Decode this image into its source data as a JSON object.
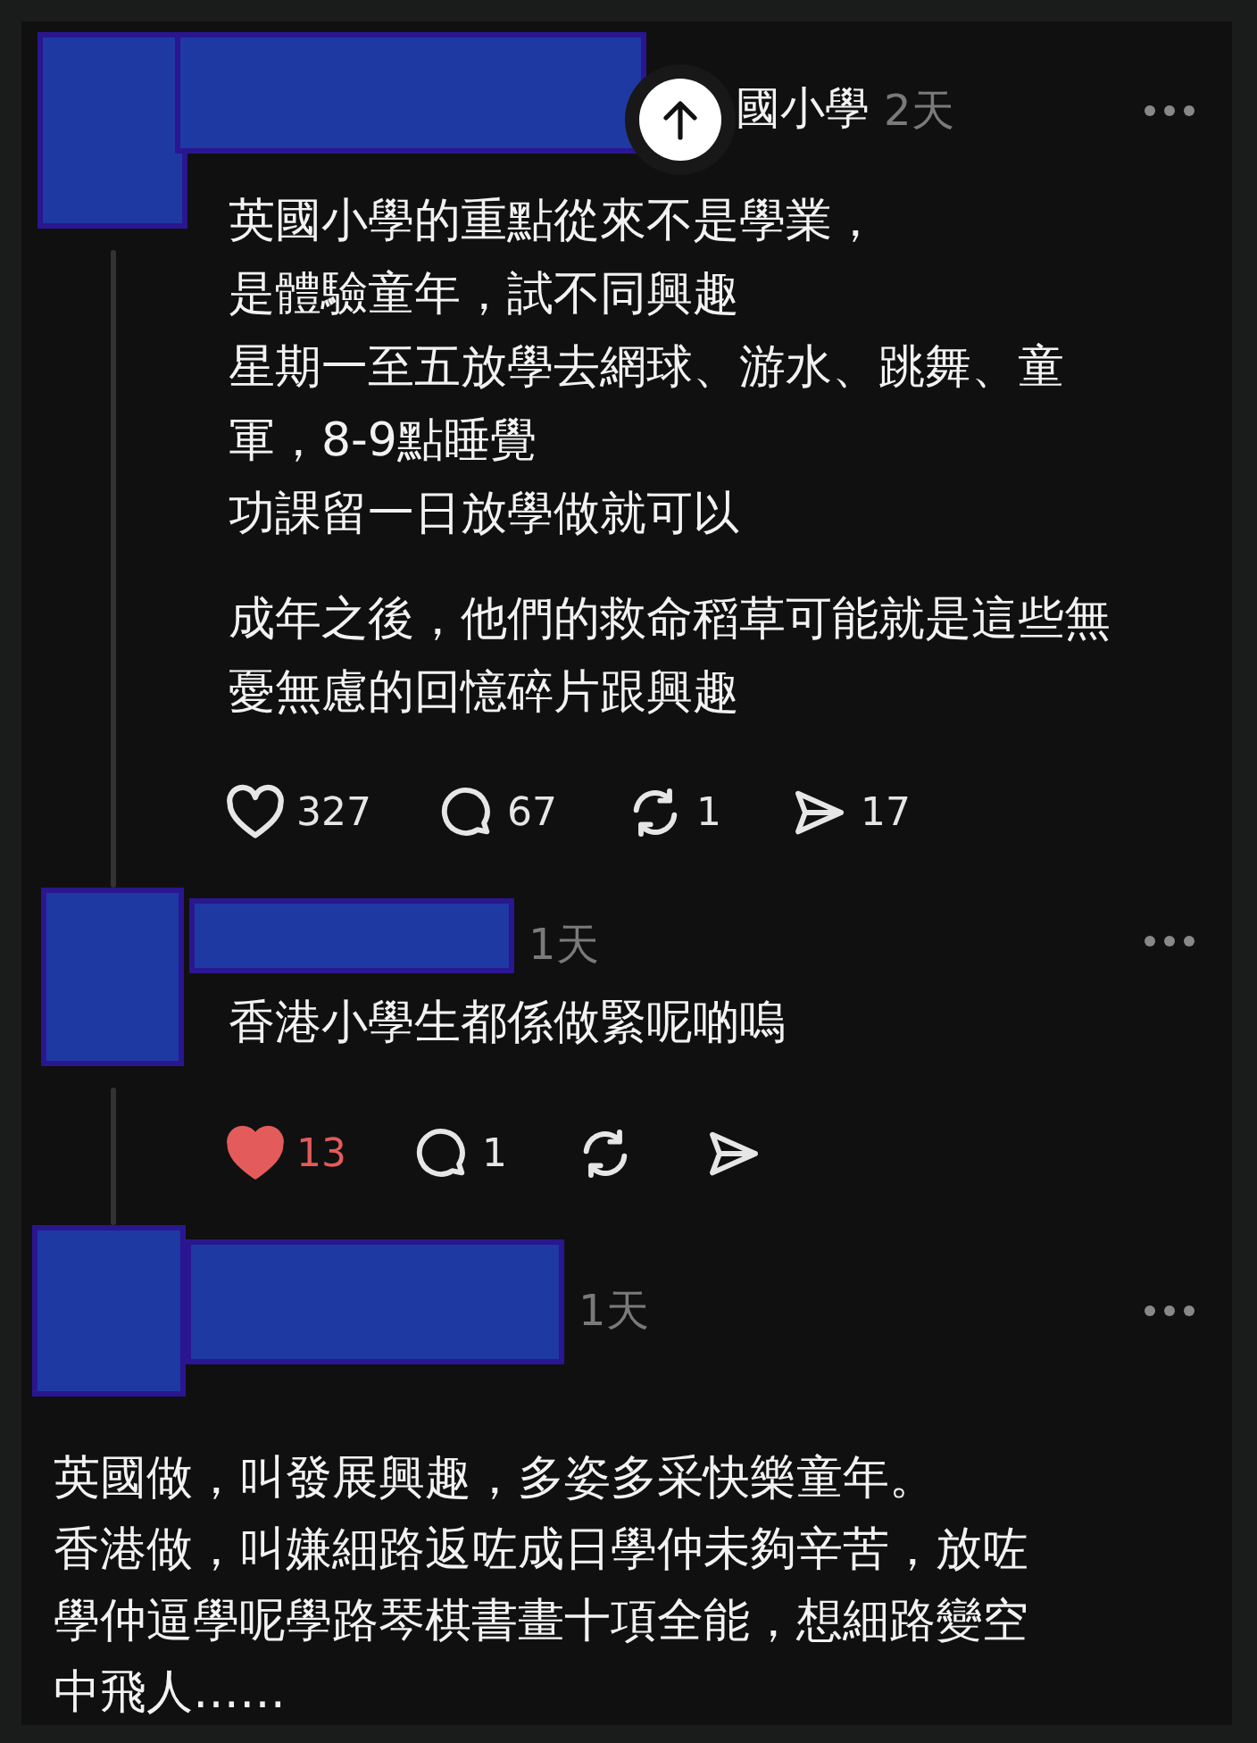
{
  "posts": [
    {
      "kind": "thread",
      "author_tail": "國小學",
      "time": "2天",
      "paragraphs": [
        [
          "英國小學的重點從來不是學業，",
          "是體驗童年，試不同興趣",
          "星期一至五放學去網球、游水、跳舞、童軍，8-9點睡覺",
          "功課留一日放學做就可以"
        ],
        [
          "成年之後，他們的救命稻草可能就是這些無憂無慮的回憶碎片跟興趣"
        ]
      ],
      "actions": [
        {
          "kind": "like",
          "count": "327",
          "selected": false
        },
        {
          "kind": "reply",
          "count": "67"
        },
        {
          "kind": "repost",
          "count": "1"
        },
        {
          "kind": "share",
          "count": "17"
        }
      ]
    },
    {
      "kind": "reply",
      "time": "1天",
      "paragraphs": [
        [
          "香港小學生都係做緊呢啲嗚"
        ]
      ],
      "actions": [
        {
          "kind": "like",
          "count": "13",
          "selected": true
        },
        {
          "kind": "reply",
          "count": "1"
        },
        {
          "kind": "repost"
        },
        {
          "kind": "share"
        }
      ]
    },
    {
      "kind": "standalone",
      "time": "1天",
      "paragraphs": [
        [
          "英國做，叫發展興趣，多姿多采快樂童年。",
          "香港做，叫嫌細路返咗成日學仲未夠辛苦，放咗學仲逼學呢學路琴棋書畫十項全能，想細路變空中飛人……"
        ]
      ]
    }
  ]
}
